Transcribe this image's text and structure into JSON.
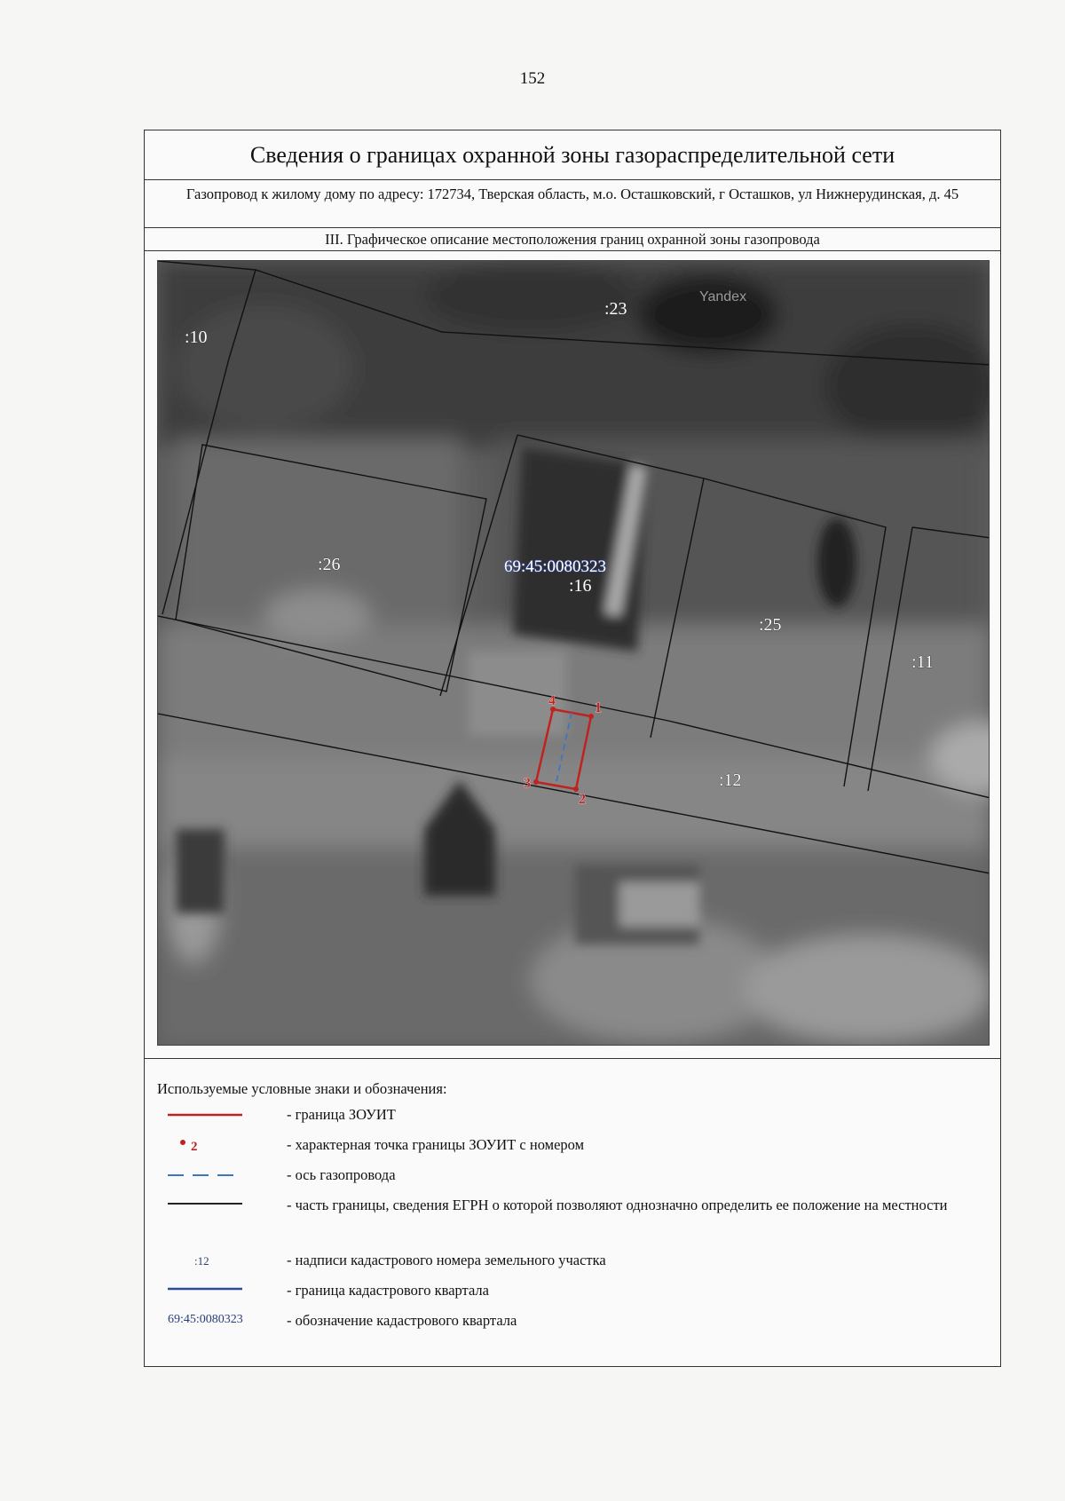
{
  "page_number": "152",
  "header": {
    "title": "Сведения о границах охранной зоны газораспределительной сети",
    "subtitle": "Газопровод к жилому дому по адресу: 172734, Тверская область, м.о. Осташковский, г Осташков, ул Нижнерудинская, д. 45",
    "section": "III. Графическое описание местоположения границ охранной зоны газопровода"
  },
  "map": {
    "watermark": "Yandex",
    "quarter_label": "69:45:0080323",
    "parcels": [
      ":23",
      ":10",
      ":26",
      ":16",
      ":25",
      ":11",
      ":12"
    ],
    "boundary_points": [
      "1",
      "2",
      "3",
      "4"
    ],
    "colors": {
      "zone_boundary": "#c0231f",
      "gas_axis": "#3a78c2",
      "parcel_border": "#111111",
      "quarter_border": "#2d4d9a",
      "quarter_label": "#3b4fa8"
    }
  },
  "legend": {
    "title": "Используемые условные знаки и обозначения:",
    "items": [
      {
        "symbol": "red-line",
        "text": "- граница ЗОУИТ"
      },
      {
        "symbol": "red-point",
        "point_label": "2",
        "text": "- характерная точка границы ЗОУИТ с номером"
      },
      {
        "symbol": "blue-dashed-line",
        "text": "- ось газопровода"
      },
      {
        "symbol": "black-line",
        "text": "- часть границы, сведения ЕГРН о которой позволяют однозначно определить ее положение на местности"
      },
      {
        "symbol": "parcel-label",
        "sample": ":12",
        "text": "- надписи кадастрового номера земельного участка"
      },
      {
        "symbol": "blue-line",
        "text": "- граница кадастрового квартала"
      },
      {
        "symbol": "quarter-label",
        "sample": "69:45:0080323",
        "text": "- обозначение кадастрового квартала"
      }
    ]
  }
}
